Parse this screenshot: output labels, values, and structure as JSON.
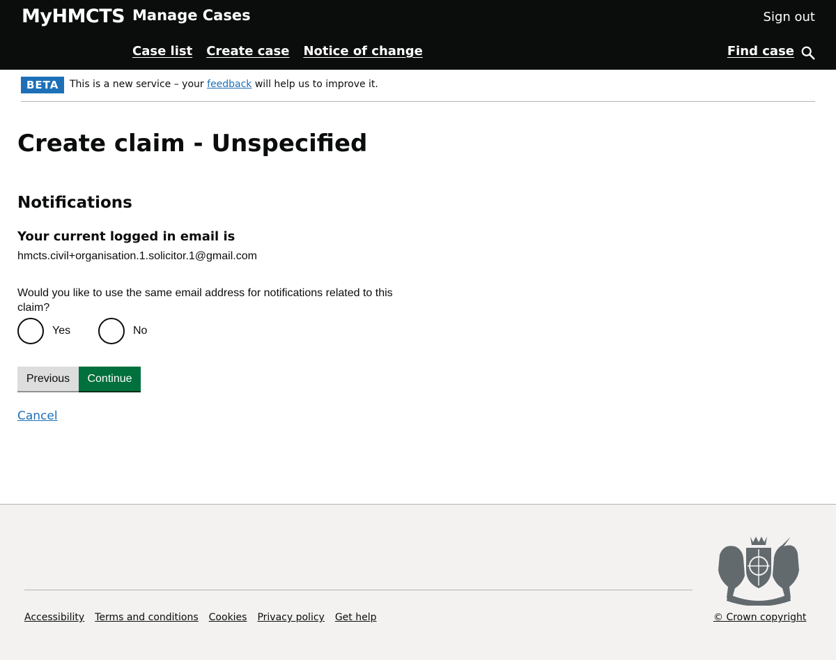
{
  "header": {
    "brand": "MyHMCTS",
    "service_name": "Manage Cases",
    "sign_out": "Sign out",
    "nav": [
      "Case list",
      "Create case",
      "Notice of change"
    ],
    "find_case": "Find case"
  },
  "beta_banner": {
    "tag": "BETA",
    "text_before": "This is a new service – your",
    "link": "feedback",
    "text_after": "will help us to improve it."
  },
  "main": {
    "page_title": "Create claim - Unspecified",
    "section_heading": "Notifications",
    "email_label": "Your current logged in email is",
    "email_value": "hmcts.civil+organisation.1.solicitor.1@gmail.com",
    "question": "Would you like to use the same email address for notifications related to this claim?",
    "options": [
      "Yes",
      "No"
    ],
    "previous_button": "Previous",
    "continue_button": "Continue",
    "cancel_link": "Cancel"
  },
  "footer": {
    "links": [
      "Accessibility",
      "Terms and conditions",
      "Cookies",
      "Privacy policy",
      "Get help"
    ],
    "copyright": "© Crown copyright"
  },
  "colors": {
    "header_bg": "#0b0c0c",
    "beta_tag": "#1d70b8",
    "link": "#1d70b8",
    "continue_bg": "#00703c",
    "previous_bg": "#dddddd",
    "footer_bg": "#f3f2f1"
  }
}
